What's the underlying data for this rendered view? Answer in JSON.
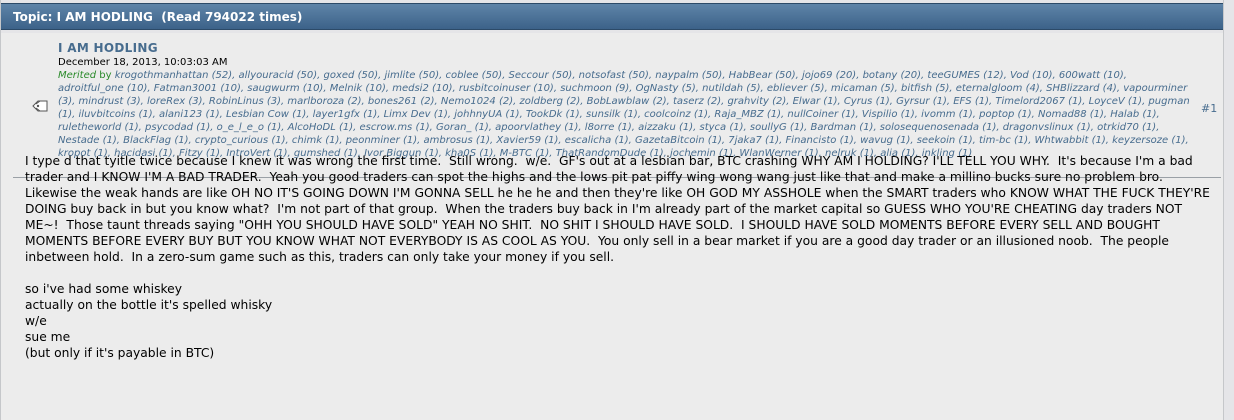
{
  "topic": {
    "label": "Topic: I AM HODLING  (Read 794022 times)"
  },
  "post": {
    "author": "I AM HODLING",
    "date": "December 18, 2013, 10:03:03 AM",
    "merited_label": "Merited",
    "merited_by": "by",
    "merited_list": "krogothmanhattan (52), allyouracid (50), goxed (50), jimlite (50), coblee (50), Seccour (50), notsofast (50), naypalm (50), HabBear (50), jojo69 (20), botany (20), teeGUMES (12), Vod (10), 600watt (10), adroitful_one (10), Fatman3001 (10), saugwurm (10), Melnik (10), medsi2 (10), rusbitcoinuser (10), suchmoon (9), OgNasty (5), nutildah (5), ebliever (5), micaman (5), bitfish (5), eternalgloom (4), SHBlizzard (4), vapourminer (3), mindrust (3), loreRex (3), RobinLinus (3), marlboroza (2), bones261 (2), Nemo1024 (2), zoldberg (2), BobLawblaw (2), taserz (2), grahvity (2), Elwar (1), Cyrus (1), Gyrsur (1), EFS (1), Timelord2067 (1), LoyceV (1), pugman (1), iluvbitcoins (1), alani123 (1), Lesbian Cow (1), layer1gfx (1), Limx Dev (1), johhnyUA (1), TookDk (1), sunsilk (1), coolcoinz (1), Raja_MBZ (1), nullCoiner (1), Vispilio (1), ivomm (1), poptop (1), Nomad88 (1), Halab (1), ruletheworld (1), psycodad (1), o_e_l_e_o (1), AlcoHoDL (1), escrow.ms (1), Goran_ (1), apoorvlathey (1), l8orre (1), aizzaku (1), styca (1), soullyG (1), Bardman (1), solosequenosenada (1), dragonvslinux (1), otrkid70 (1), Nestade (1), BlackFlag (1), crypto_curious (1), chimk (1), peonminer (1), ambrosus (1), Xavier59 (1), escalicha (1), GazetaBitcoin (1), 7jaka7 (1), Financisto (1), wavug (1), seekoin (1), tim-bc (1), Whtwabbit (1), keyzersoze (1), kropot (1), hacidasi (1), Fitzy (1), IntroVert (1), gumshed (1), Ivor Biggun (1), kha0S (1), M-BTC (1), ThatRandomDude (1), jochemin (1), WlanWerner (1), nelruk (1), alia (1), inkling (1)",
    "post_number": "#1",
    "icon": "post-icon",
    "body_paragraph": "I type d that tyitle twice because I knew it was wrong the first time.  Still wrong.  w/e.  GF's out at a lesbian bar, BTC crashing WHY AM I HOLDING? I'LL TELL YOU WHY.  It's because I'm a bad trader and I KNOW I'M A BAD TRADER.  Yeah you good traders can spot the highs and the lows pit pat piffy wing wong wang just like that and make a millino bucks sure no problem bro.  Likewise the weak hands are like OH NO IT'S GOING DOWN I'M GONNA SELL he he he and then they're like OH GOD MY ASSHOLE when the SMART traders who KNOW WHAT THE FUCK THEY'RE DOING buy back in but you know what?  I'm not part of that group.  When the traders buy back in I'm already part of the market capital so GUESS WHO YOU'RE CHEATING day traders NOT ME~!  Those taunt threads saying \"OHH YOU SHOULD HAVE SOLD\" YEAH NO SHIT.  NO SHIT I SHOULD HAVE SOLD.  I SHOULD HAVE SOLD MOMENTS BEFORE EVERY SELL AND BOUGHT MOMENTS BEFORE EVERY BUY BUT YOU KNOW WHAT NOT EVERYBODY IS AS COOL AS YOU.  You only sell in a bear market if you are a good day trader or an illusioned noob.  The people inbetween hold.  In a zero-sum game such as this, traders can only take your money if you sell.",
    "body_lines": [
      "so i've had some whiskey",
      "actually on the bottle it's spelled whisky",
      "w/e",
      "sue me",
      "(but only if it's payable in BTC)"
    ]
  },
  "colors": {
    "header_bg": "#476c8e",
    "link": "#476c8e",
    "merited_green": "#2a8a2a"
  }
}
